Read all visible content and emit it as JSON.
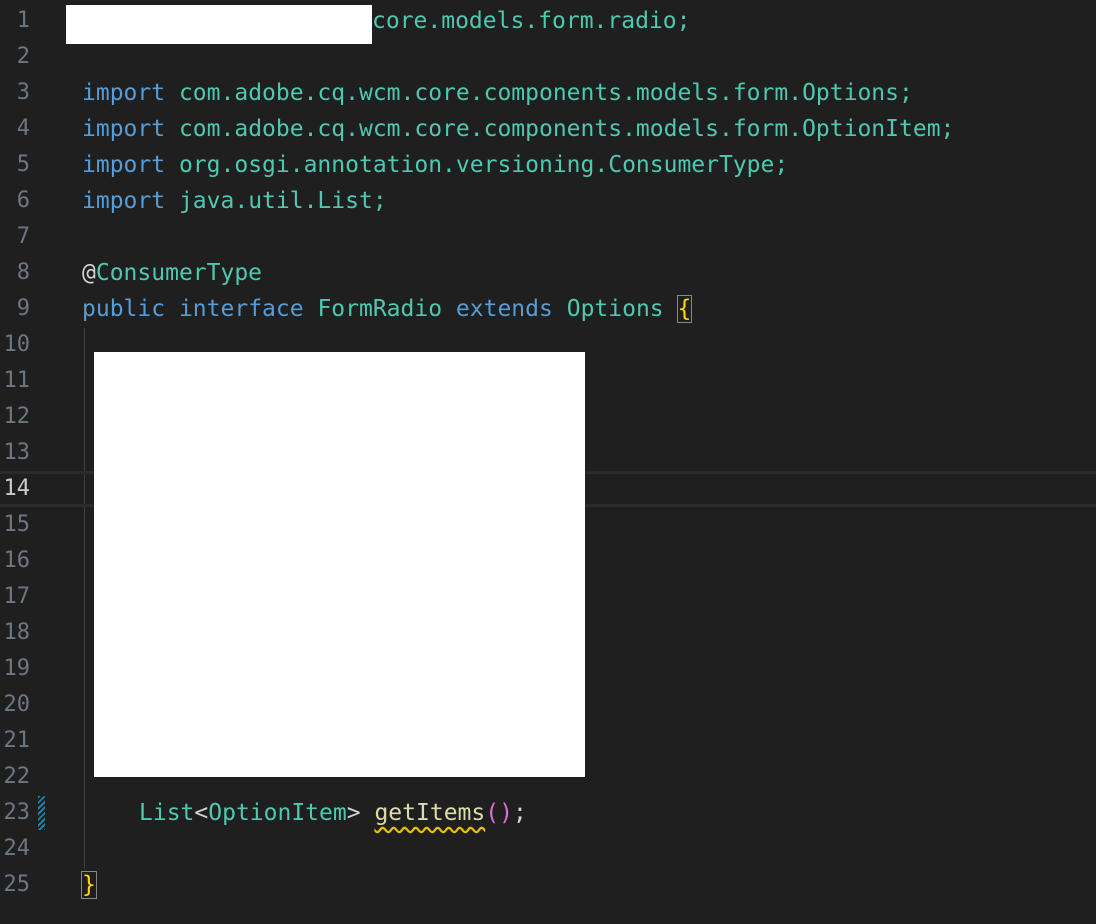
{
  "editor": {
    "line_numbers": [
      "1",
      "2",
      "3",
      "4",
      "5",
      "6",
      "7",
      "8",
      "9",
      "10",
      "11",
      "12",
      "13",
      "14",
      "15",
      "16",
      "17",
      "18",
      "19",
      "20",
      "21",
      "22",
      "23",
      "24",
      "25"
    ],
    "active_line": "14",
    "code": {
      "l1_tail": "core.models.form.radio;",
      "imports": [
        {
          "kw": "import",
          "path": "com.adobe.cq.wcm.core.components.models.form.Options;"
        },
        {
          "kw": "import",
          "path": "com.adobe.cq.wcm.core.components.models.form.OptionItem;"
        },
        {
          "kw": "import",
          "path": "org.osgi.annotation.versioning.ConsumerType;"
        },
        {
          "kw": "import",
          "path": "java.util.List;"
        }
      ],
      "annotation_at": "@",
      "annotation_name": "ConsumerType",
      "decl_public": "public",
      "decl_interface": "interface",
      "decl_name": "FormRadio",
      "decl_extends": "extends",
      "decl_super": "Options",
      "open_brace": "{",
      "method_type": "List",
      "method_lt": "<",
      "method_generic": "OptionItem",
      "method_gt": ">",
      "method_name": "getItems",
      "method_parens": "()",
      "method_semicolon": ";",
      "close_brace": "}"
    },
    "colors": {
      "background": "#1f1f1f",
      "keyword": "#569cd6",
      "type": "#4ec9b0",
      "function": "#dcdcaa",
      "bracket": "#ffd700"
    }
  }
}
